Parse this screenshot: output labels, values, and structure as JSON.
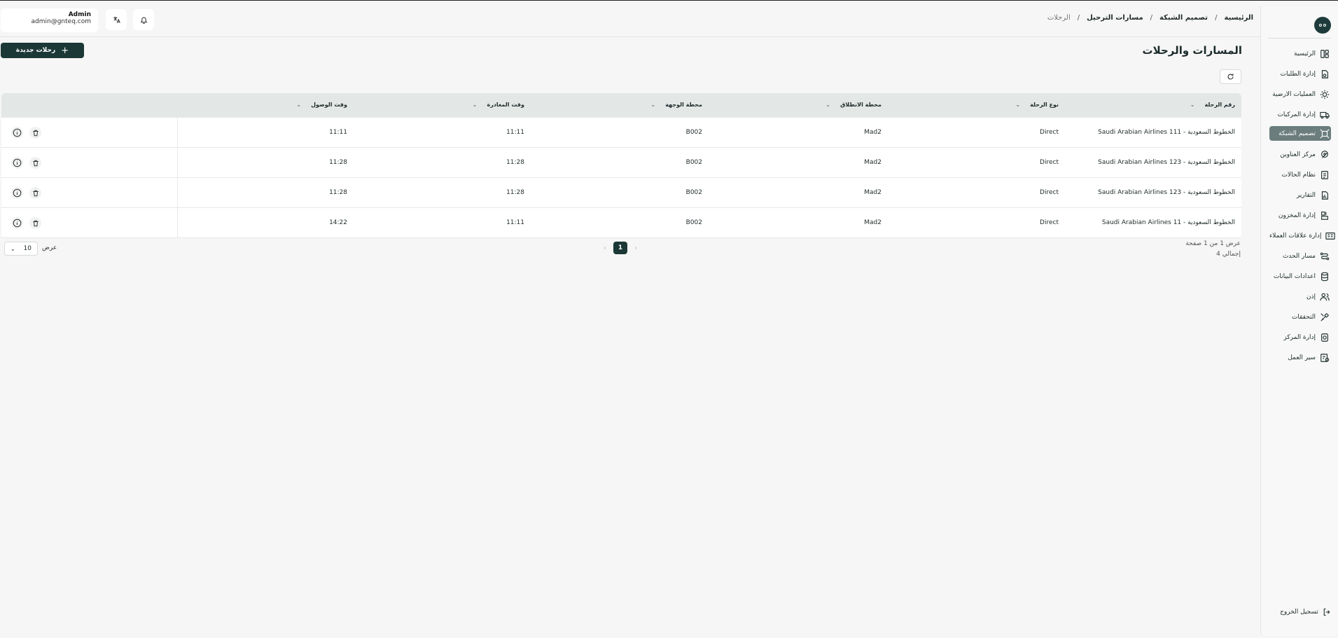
{
  "header": {
    "breadcrumbs": [
      "الرئيسية",
      "تصميم الشبكة",
      "مسارات الترحيل",
      "الرحلات"
    ],
    "user_name": "Admin",
    "user_email": "admin@gnteq.com"
  },
  "sidebar": {
    "items": [
      {
        "label": "الرئيسية",
        "icon": "home-icon"
      },
      {
        "label": "إدارة الطلبات",
        "icon": "orders-icon"
      },
      {
        "label": "العمليات الارضية",
        "icon": "ground-ops-icon"
      },
      {
        "label": "إدارة المركبات",
        "icon": "truck-icon"
      },
      {
        "label": "تصميم الشبكة",
        "icon": "network-icon",
        "active": true
      },
      {
        "label": "مركز العناوين",
        "icon": "location-icon"
      },
      {
        "label": "نظام الحالات",
        "icon": "status-icon"
      },
      {
        "label": "التقارير",
        "icon": "report-icon"
      },
      {
        "label": "إدارة المخزون",
        "icon": "inventory-icon"
      },
      {
        "label": "إدارة علاقات العملاء",
        "icon": "crm-icon"
      },
      {
        "label": "مسار الحدث",
        "icon": "event-path-icon"
      },
      {
        "label": "اعدادات البيانات",
        "icon": "database-icon"
      },
      {
        "label": "إذن",
        "icon": "users-icon"
      },
      {
        "label": "التحققات",
        "icon": "tools-icon"
      },
      {
        "label": "إدارة المركز",
        "icon": "hub-icon"
      },
      {
        "label": "سير العمل",
        "icon": "workflow-icon"
      }
    ],
    "logout": "تسجيل الخروج"
  },
  "main": {
    "title": "المسارات والرحلات",
    "new_button": "رحلات جديدة",
    "columns": [
      "رقم الرحلة",
      "نوع الرحلة",
      "محطة الانطلاق",
      "محطة الوجهة",
      "وقت المغادرة",
      "وقت الوصول"
    ],
    "rows": [
      {
        "flight": "Saudi Arabian Airlines الخطوط السعودية - 111",
        "type": "Direct",
        "origin": "Mad2",
        "dest": "B002",
        "departure": "11:11",
        "arrival": "11:11"
      },
      {
        "flight": "Saudi Arabian Airlines الخطوط السعودية - 123",
        "type": "Direct",
        "origin": "Mad2",
        "dest": "B002",
        "departure": "11:28",
        "arrival": "11:28"
      },
      {
        "flight": "Saudi Arabian Airlines الخطوط السعودية - 123",
        "type": "Direct",
        "origin": "Mad2",
        "dest": "B002",
        "departure": "11:28",
        "arrival": "11:28"
      },
      {
        "flight": "Saudi Arabian Airlines الخطوط السعودية - 11",
        "type": "Direct",
        "origin": "Mad2",
        "dest": "B002",
        "departure": "11:11",
        "arrival": "14:22"
      }
    ],
    "pager": {
      "page_info": "عرض 1 من 1 صفحة",
      "total": "إجمالي 4",
      "current_page": "1",
      "page_size": "10",
      "page_size_label": "عرض"
    }
  }
}
